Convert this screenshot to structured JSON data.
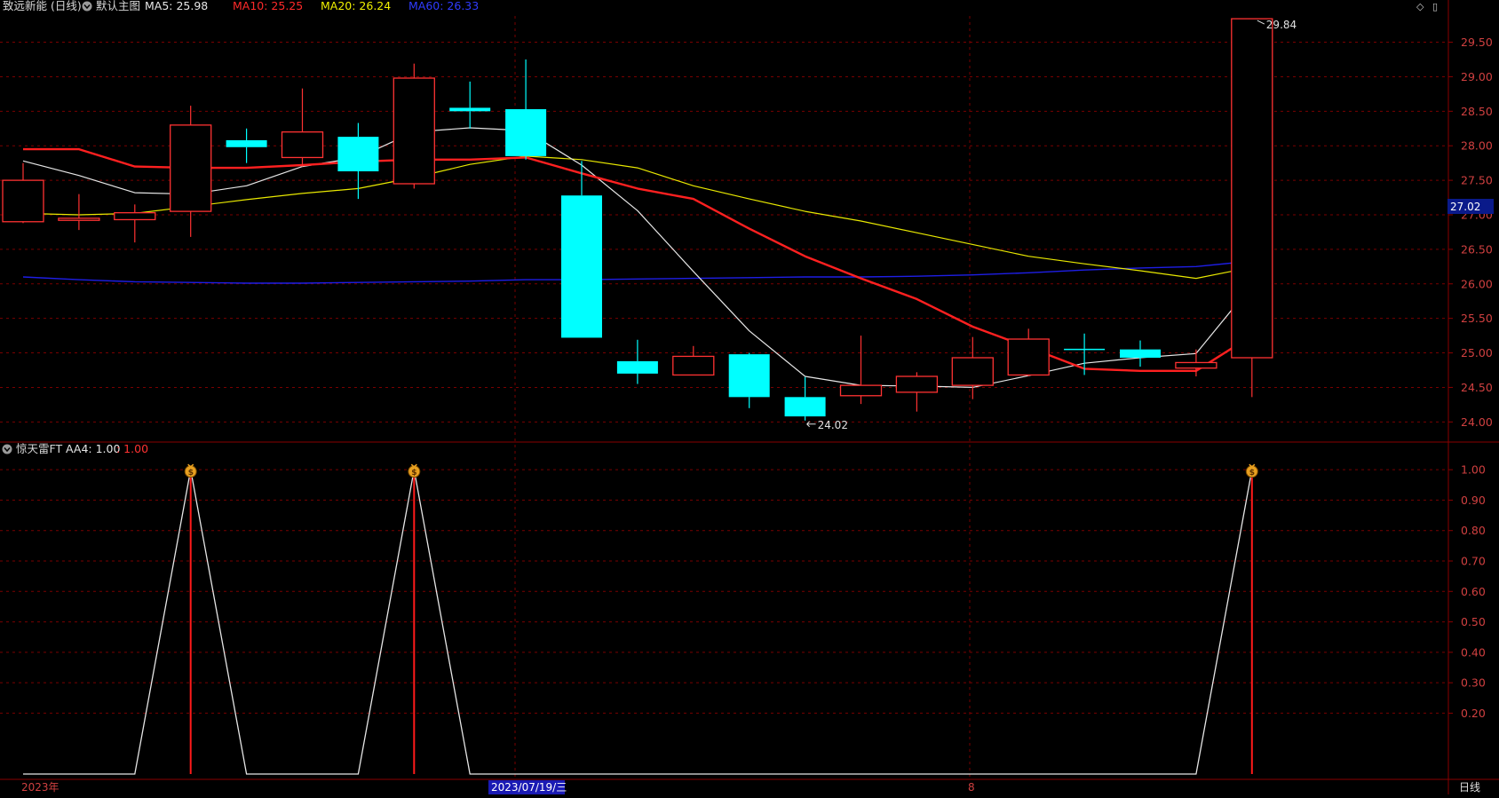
{
  "main_header": {
    "stock": "致远新能 (日线)",
    "template": "默认主图",
    "ma": [
      {
        "label": "MA5: 25.98",
        "color": "#e6e6e6"
      },
      {
        "label": "MA10: 25.25",
        "color": "#ff2a2a"
      },
      {
        "label": "MA20: 26.24",
        "color": "#f0f000"
      },
      {
        "label": "MA60: 26.33",
        "color": "#2f3cff"
      }
    ],
    "window_icons": [
      "◇",
      "▯"
    ]
  },
  "indicator_header": {
    "name": "惊天雷FT",
    "label": "AA4: 1.00",
    "value2": ": 1.00"
  },
  "price_axis": {
    "ticks": [
      "29.50",
      "29.00",
      "28.50",
      "28.00",
      "27.50",
      "27.00",
      "26.50",
      "26.00",
      "25.50",
      "25.00",
      "24.50",
      "24.00"
    ],
    "current_price": "27.02"
  },
  "indicator_axis": {
    "ticks": [
      "1.00",
      "0.90",
      "0.80",
      "0.70",
      "0.60",
      "0.50",
      "0.40",
      "0.30",
      "0.20"
    ]
  },
  "date_axis": {
    "left": "2023年",
    "cursor": "2023/07/19/三",
    "mark": "8",
    "period": "日线"
  },
  "annotations": {
    "high": "29.84",
    "low": "24.02"
  },
  "colors": {
    "up": "#ff3232",
    "down": "#00ffff",
    "ma5": "#e6e6e6",
    "ma10": "#ff2020",
    "ma20": "#e8e800",
    "ma60": "#1e1ee6",
    "grid": "#7a0000",
    "axis_text": "#d04040"
  },
  "chart_data": {
    "type": "candlestick",
    "candles": [
      {
        "o": 26.9,
        "c": 27.5,
        "h": 27.75,
        "l": 26.88
      },
      {
        "o": 26.92,
        "c": 26.95,
        "h": 27.3,
        "l": 26.78
      },
      {
        "o": 26.93,
        "c": 27.03,
        "h": 27.15,
        "l": 26.6
      },
      {
        "o": 27.05,
        "c": 28.3,
        "h": 28.58,
        "l": 26.68
      },
      {
        "o": 28.08,
        "c": 27.98,
        "h": 28.25,
        "l": 27.75
      },
      {
        "o": 27.83,
        "c": 28.2,
        "h": 28.83,
        "l": 27.7
      },
      {
        "o": 28.13,
        "c": 27.63,
        "h": 28.33,
        "l": 27.23
      },
      {
        "o": 27.45,
        "c": 28.98,
        "h": 29.19,
        "l": 27.38
      },
      {
        "o": 28.55,
        "c": 28.5,
        "h": 28.93,
        "l": 28.25
      },
      {
        "o": 28.53,
        "c": 27.85,
        "h": 29.25,
        "l": 27.8
      },
      {
        "o": 27.28,
        "c": 25.22,
        "h": 27.78,
        "l": 25.22
      },
      {
        "o": 24.88,
        "c": 24.7,
        "h": 25.19,
        "l": 24.55
      },
      {
        "o": 24.68,
        "c": 24.95,
        "h": 25.1,
        "l": 24.68
      },
      {
        "o": 24.98,
        "c": 24.36,
        "h": 25.0,
        "l": 24.2
      },
      {
        "o": 24.36,
        "c": 24.08,
        "h": 24.65,
        "l": 24.02
      },
      {
        "o": 24.38,
        "c": 24.53,
        "h": 25.25,
        "l": 24.26
      },
      {
        "o": 24.43,
        "c": 24.66,
        "h": 24.72,
        "l": 24.15
      },
      {
        "o": 24.53,
        "c": 24.93,
        "h": 25.23,
        "l": 24.33
      },
      {
        "o": 24.68,
        "c": 25.2,
        "h": 25.35,
        "l": 24.66
      },
      {
        "o": 25.06,
        "c": 25.05,
        "h": 25.28,
        "l": 24.68
      },
      {
        "o": 25.05,
        "c": 24.93,
        "h": 25.18,
        "l": 24.8
      },
      {
        "o": 24.78,
        "c": 24.86,
        "h": 25.05,
        "l": 24.66
      },
      {
        "o": 24.93,
        "c": 29.84,
        "h": 29.84,
        "l": 24.36
      }
    ],
    "ma5": [
      27.78,
      27.57,
      27.32,
      27.3,
      27.42,
      27.7,
      27.83,
      28.2,
      28.26,
      28.22,
      27.72,
      27.06,
      26.18,
      25.32,
      24.66,
      24.53,
      24.52,
      24.5,
      24.67,
      24.85,
      24.93,
      24.99,
      25.98
    ],
    "ma10": [
      27.95,
      27.95,
      27.7,
      27.68,
      27.68,
      27.72,
      27.77,
      27.8,
      27.8,
      27.83,
      27.6,
      27.38,
      27.23,
      26.8,
      26.4,
      26.08,
      25.78,
      25.38,
      25.08,
      24.77,
      24.74,
      24.74,
      25.25
    ],
    "ma20": [
      27.02,
      27.0,
      27.02,
      27.12,
      27.22,
      27.31,
      27.38,
      27.54,
      27.73,
      27.85,
      27.8,
      27.68,
      27.42,
      27.23,
      27.05,
      26.91,
      26.74,
      26.57,
      26.4,
      26.29,
      26.19,
      26.08,
      26.24
    ],
    "ma60": [
      26.1,
      26.06,
      26.03,
      26.02,
      26.01,
      26.01,
      26.02,
      26.03,
      26.04,
      26.06,
      26.06,
      26.07,
      26.08,
      26.09,
      26.1,
      26.1,
      26.11,
      26.13,
      26.16,
      26.2,
      26.23,
      26.25,
      26.33
    ],
    "aa4": [
      0,
      0,
      0,
      1,
      0,
      0,
      0,
      1,
      0,
      0,
      0,
      0,
      0,
      0,
      0,
      0,
      0,
      0,
      0,
      0,
      0,
      0,
      1
    ],
    "price_ylim": [
      23.85,
      29.88
    ],
    "indicator_ylim": [
      0,
      1.05
    ],
    "signal_icon": "money-bag-icon"
  }
}
